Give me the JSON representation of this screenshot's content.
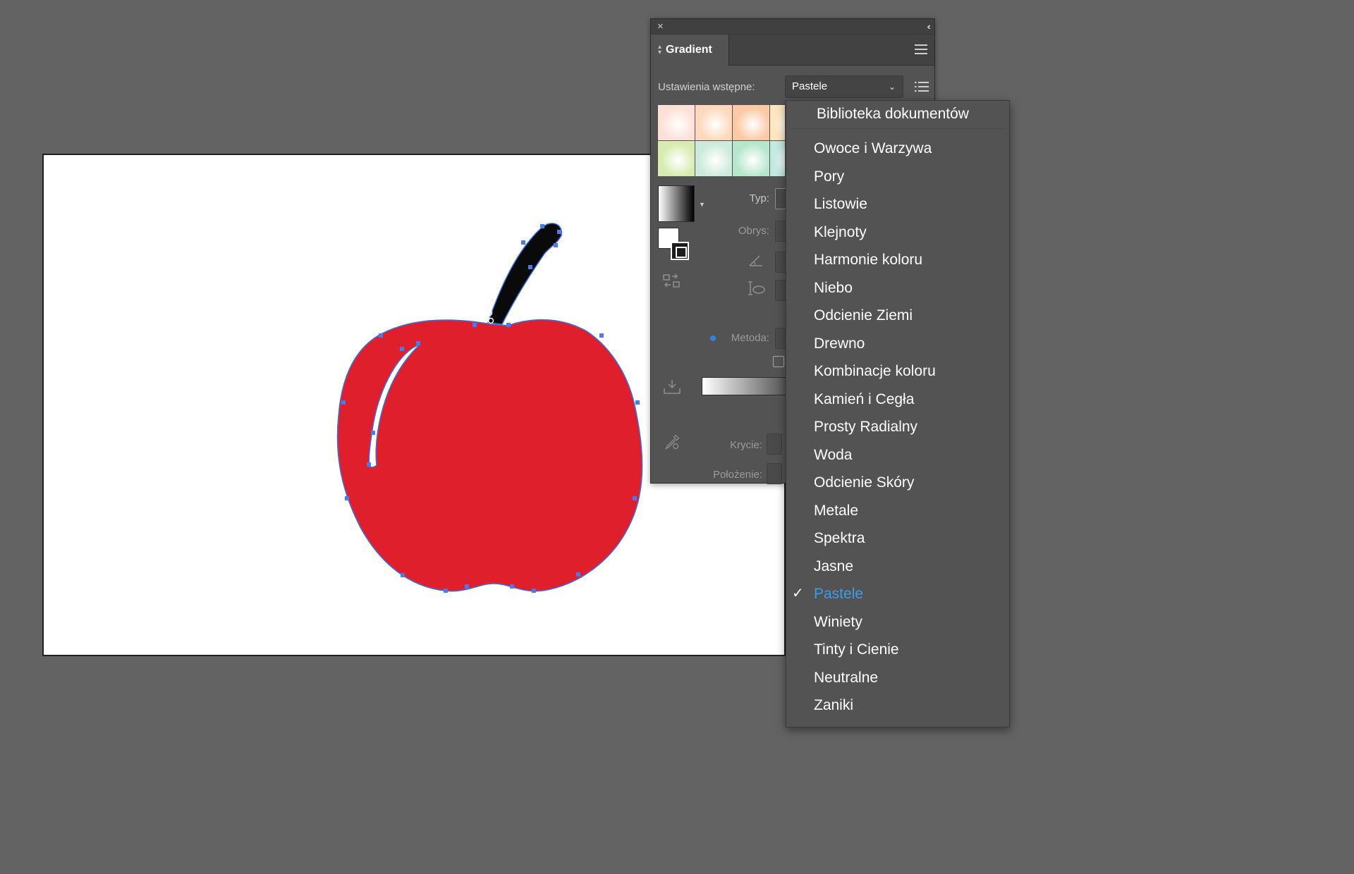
{
  "panel": {
    "tab_title": "Gradient",
    "close_glyph": "×",
    "collapse_glyph": "‹‹",
    "preset_label": "Ustawienia wstępne:",
    "preset_value": "Pastele",
    "labels": {
      "typ": "Typ:",
      "obrys": "Obrys:",
      "metoda": "Metoda:",
      "krycie": "Krycie:",
      "polozenie": "Położenie:"
    },
    "swatch_colors": [
      "#fde0d6",
      "#fdd8bc",
      "#fbc9a4",
      "#fde6c0",
      "#d8ebb0",
      "#cdebdc",
      "#b6e7cc",
      "#c4e9e0"
    ]
  },
  "menu": {
    "header": "Biblioteka dokumentów",
    "items": [
      "Owoce i Warzywa",
      "Pory",
      "Listowie",
      "Klejnoty",
      "Harmonie koloru",
      "Niebo",
      "Odcienie Ziemi",
      "Drewno",
      "Kombinacje koloru",
      "Kamień i Cegła",
      "Prosty Radialny",
      "Woda",
      "Odcienie Skóry",
      "Metale",
      "Spektra",
      "Jasne",
      "Pastele",
      "Winiety",
      "Tinty i Cienie",
      "Neutralne",
      "Zaniki"
    ],
    "selected": "Pastele",
    "check_glyph": "✓"
  },
  "colors": {
    "apple_fill": "#e01f2c",
    "selection": "#3d6fe0",
    "selected_item": "#3d9bf0"
  },
  "icons": {
    "close": "close-icon",
    "collapse": "collapse-icon",
    "menu": "panel-menu-icon",
    "list": "list-icon",
    "chevron": "chevron-down-icon",
    "check": "checkmark-icon"
  }
}
